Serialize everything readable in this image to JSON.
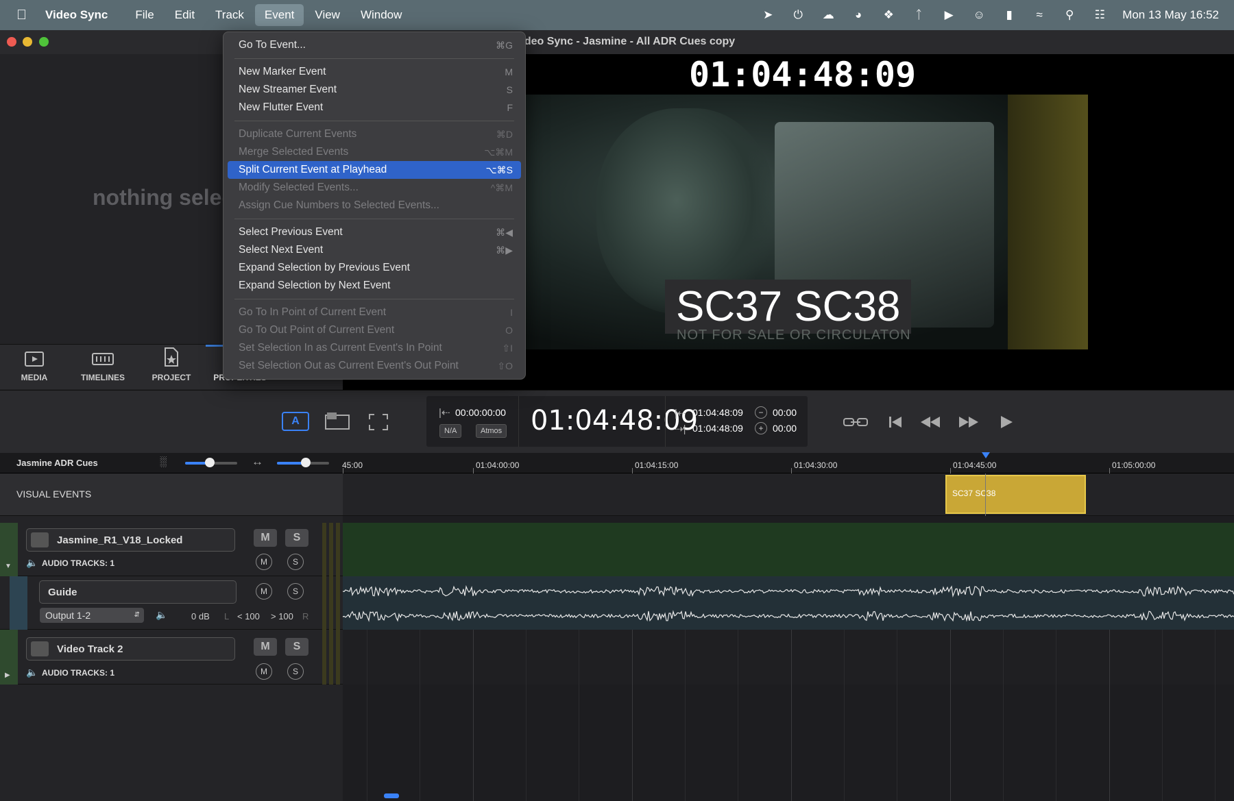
{
  "menubar": {
    "app_name": "Video Sync",
    "menus": [
      "File",
      "Edit",
      "Track",
      "Event",
      "View",
      "Window"
    ],
    "active_menu": "Event",
    "clock": "Mon 13 May  16:52"
  },
  "window": {
    "title": "Video Sync - Jasmine - All ADR Cues copy"
  },
  "event_menu": {
    "items": [
      {
        "label": "Go To Event...",
        "shortcut": "⌘G",
        "enabled": true
      },
      {
        "label": "New Marker Event",
        "shortcut": "M",
        "enabled": true
      },
      {
        "label": "New Streamer Event",
        "shortcut": "S",
        "enabled": true
      },
      {
        "label": "New Flutter Event",
        "shortcut": "F",
        "enabled": true
      },
      {
        "label": "Duplicate Current Events",
        "shortcut": "⌘D",
        "enabled": false
      },
      {
        "label": "Merge Selected Events",
        "shortcut": "⌥⌘M",
        "enabled": false
      },
      {
        "label": "Split Current Event at Playhead",
        "shortcut": "⌥⌘S",
        "enabled": true,
        "selected": true
      },
      {
        "label": "Modify Selected Events...",
        "shortcut": "^⌘M",
        "enabled": false
      },
      {
        "label": "Assign Cue Numbers to Selected Events...",
        "shortcut": "",
        "enabled": false
      },
      {
        "label": "Select Previous Event",
        "shortcut": "⌘◀",
        "enabled": true
      },
      {
        "label": "Select Next Event",
        "shortcut": "⌘▶",
        "enabled": true
      },
      {
        "label": "Expand Selection by Previous Event",
        "shortcut": "",
        "enabled": true
      },
      {
        "label": "Expand Selection by Next Event",
        "shortcut": "",
        "enabled": true
      },
      {
        "label": "Go To In Point of Current Event",
        "shortcut": "I",
        "enabled": false
      },
      {
        "label": "Go To Out Point of Current Event",
        "shortcut": "O",
        "enabled": false
      },
      {
        "label": "Set Selection In as Current Event's In Point",
        "shortcut": "⇧I",
        "enabled": false
      },
      {
        "label": "Set Selection Out as Current Event's Out Point",
        "shortcut": "⇧O",
        "enabled": false
      }
    ]
  },
  "left_panel": {
    "empty_text": "nothing select",
    "tabs": [
      "MEDIA",
      "TIMELINES",
      "PROJECT",
      "PROPERTIES"
    ]
  },
  "viewer": {
    "timecode": "01:04:48:09",
    "burnin": "SC37 SC38",
    "watermark": "NOT FOR SALE OR CIRCULATON"
  },
  "transport": {
    "start_tc": "00:00:00:00",
    "badge_na": "N/A",
    "badge_atmos": "Atmos",
    "main_tc": "01:04:48:09",
    "in_tc": "01:04:48:09",
    "out_tc": "01:04:48:09",
    "minus_val": "00:00",
    "plus_val": "00:00",
    "mode_label": "A"
  },
  "timeline": {
    "name": "Jasmine ADR Cues",
    "ruler": [
      "45:00",
      "01:04:00:00",
      "01:04:15:00",
      "01:04:30:00",
      "01:04:45:00",
      "01:05:00:00"
    ],
    "visual_events_label": "VISUAL EVENTS",
    "event_label": "SC37 SC38",
    "tracks": [
      {
        "name": "Jasmine_R1_V18_Locked",
        "audio_tracks": "AUDIO TRACKS: 1"
      },
      {
        "name": "Guide",
        "output": "Output 1-2",
        "gain": "0 dB",
        "pan_l": "L",
        "pan_l_val": "< 100",
        "pan_r_val": "> 100",
        "pan_r": "R"
      },
      {
        "name": "Video Track 2",
        "audio_tracks": "AUDIO TRACKS: 1"
      }
    ],
    "m_label": "M",
    "s_label": "S"
  }
}
